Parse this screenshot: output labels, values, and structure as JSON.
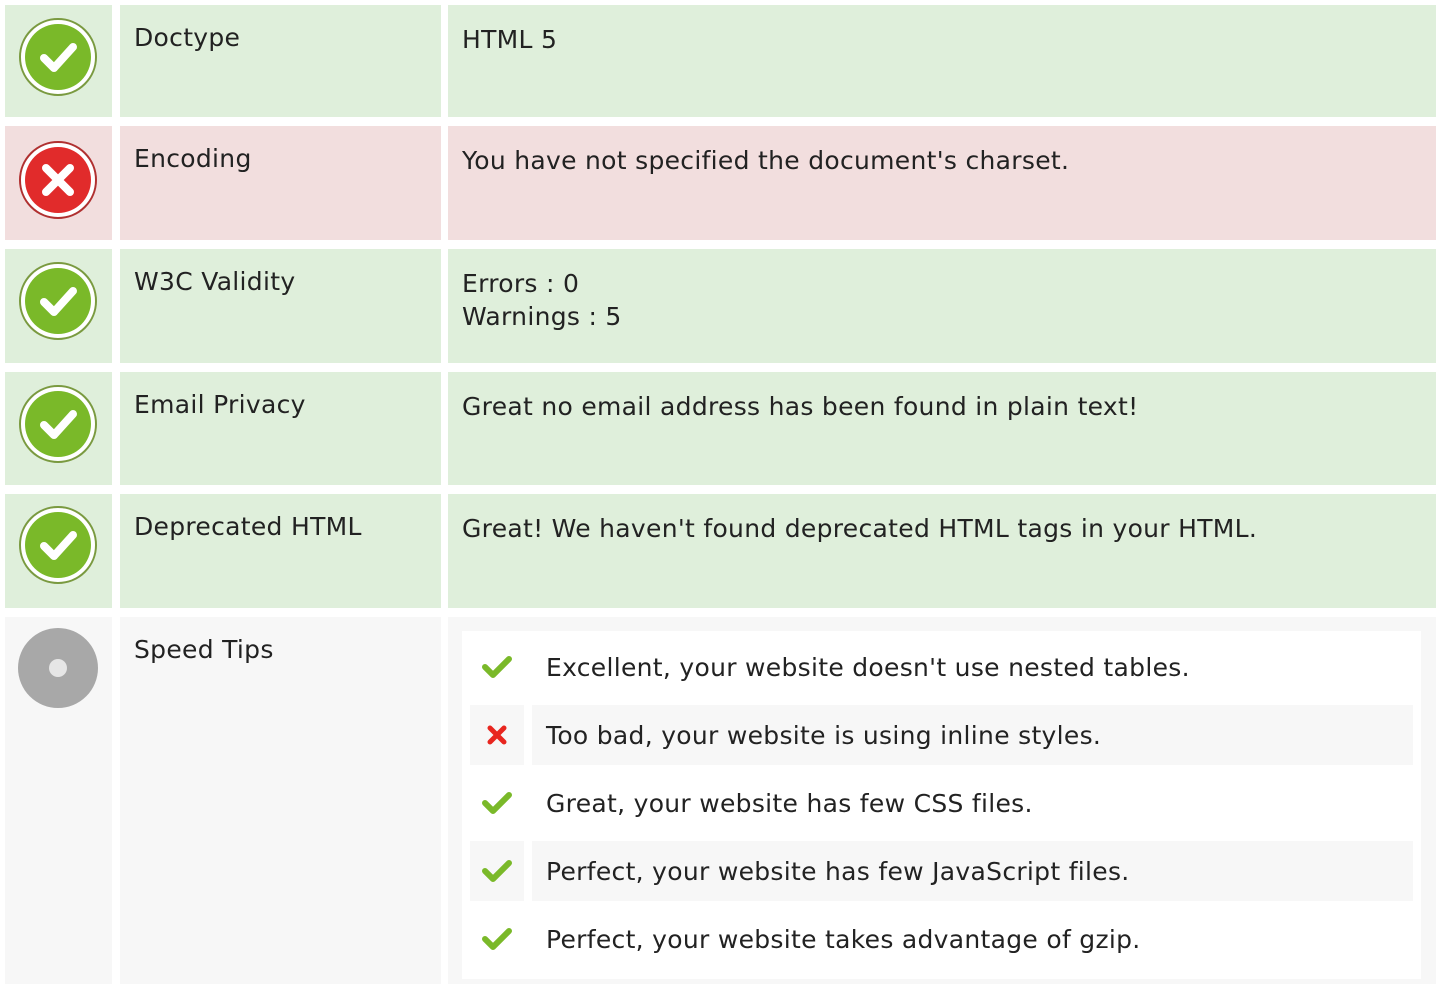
{
  "rows": [
    {
      "status": "pass",
      "label": "Doctype",
      "lines": [
        "HTML 5"
      ]
    },
    {
      "status": "fail",
      "label": "Encoding",
      "lines": [
        "You have not specified the document's charset."
      ]
    },
    {
      "status": "pass",
      "label": "W3C Validity",
      "lines": [
        "Errors : 0",
        "Warnings : 5"
      ]
    },
    {
      "status": "pass",
      "label": "Email Privacy",
      "lines": [
        "Great no email address has been found in plain text!"
      ]
    },
    {
      "status": "pass",
      "label": "Deprecated HTML",
      "lines": [
        "Great! We haven't found deprecated HTML tags in your HTML."
      ]
    }
  ],
  "speed_tips": {
    "status": "info",
    "label": "Speed Tips",
    "tips": [
      {
        "status": "pass",
        "icon": "check-icon",
        "text": "Excellent, your website doesn't use nested tables."
      },
      {
        "status": "fail",
        "icon": "cross-icon",
        "text": "Too bad, your website is using inline styles."
      },
      {
        "status": "pass",
        "icon": "check-icon",
        "text": "Great, your website has few CSS files."
      },
      {
        "status": "pass",
        "icon": "check-icon",
        "text": "Perfect, your website has few JavaScript files."
      },
      {
        "status": "pass",
        "icon": "check-icon",
        "text": "Perfect, your website takes advantage of gzip."
      }
    ]
  },
  "colors": {
    "pass_bg": "#dfefdb",
    "fail_bg": "#f2dede",
    "info_bg": "#f7f7f7",
    "pass_icon": "#7ab929",
    "fail_icon": "#e12b2b",
    "info_icon": "#a8a8a8"
  }
}
